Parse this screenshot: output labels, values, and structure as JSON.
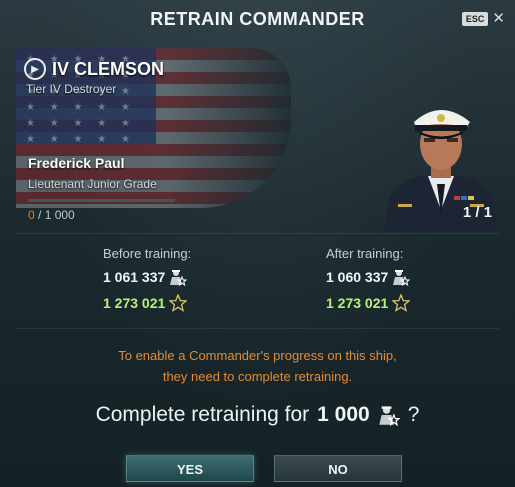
{
  "dialog": {
    "title": "RETRAIN COMMANDER",
    "esc_label": "ESC",
    "close_glyph": "✕"
  },
  "ship": {
    "name": "IV CLEMSON",
    "subtitle": "Tier IV Destroyer",
    "class_icon": "destroyer-class-icon"
  },
  "commander": {
    "name": "Frederick Paul",
    "rank": "Lieutenant Junior Grade",
    "xp_current": "0",
    "xp_max": "/ 1 000",
    "progress_fraction": 0,
    "count": "1 / 1"
  },
  "before": {
    "label": "Before training:",
    "commander_xp": "1 061 337",
    "free_xp": "1 273 021"
  },
  "after": {
    "label": "After training:",
    "commander_xp": "1 060 337",
    "free_xp": "1 273 021"
  },
  "notice": {
    "line1": "To enable a Commander's progress on this ship,",
    "line2": "they need to complete retraining."
  },
  "confirm": {
    "prefix": "Complete retraining for",
    "amount": "1 000",
    "suffix": "?"
  },
  "buttons": {
    "yes": "YES",
    "no": "NO"
  },
  "colors": {
    "accent_orange": "#e58a35",
    "free_xp_green": "#b9f07b",
    "yes_button": "#2f5c60",
    "no_button": "#31434a"
  }
}
